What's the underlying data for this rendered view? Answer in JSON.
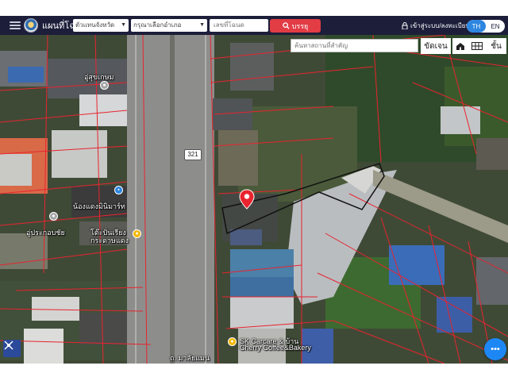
{
  "app": {
    "title": "แผนที่โฉนด"
  },
  "header": {
    "province": {
      "value": "ตัวแทนจังหวัด"
    },
    "district": {
      "value": "กรุณาเลือกอำเภอ"
    },
    "deed": {
      "placeholder": "เลขที่โฉนด"
    },
    "search_label": "บรรยุ",
    "login_label": "เข้าสู่ระบบ/ลงทะเบียน",
    "lang": {
      "th": "TH",
      "en": "EN"
    }
  },
  "map": {
    "place_search": {
      "placeholder": "ค้นหาสถานที่สำคัญ"
    },
    "tools": {
      "clear": "ขัดเจน",
      "floors": "ชั้น"
    },
    "route_badge": "321",
    "labels": {
      "a": "อู่สุขเกษม",
      "b": "น้องแดงมินิมาร์ท",
      "c": "อู่ประกอบชัย",
      "d": "โต๊ะปั่นเรียงกระดาษแดง",
      "e": "SK Carcare & บ้าน",
      "f": "Cherry Coffee&Bakery",
      "g": "ถ. มาลัยแมน"
    }
  },
  "colors": {
    "topbar": "#1c1e3a",
    "search_button": "#e23c45",
    "lang_active": "#2d86e0",
    "parcel_line": "#e8242f",
    "marker": "#e8242f",
    "fab": "#1d88f5",
    "layers_button": "#2c4a9a"
  },
  "icons": {
    "menu": "hamburger-icon",
    "logo": "emblem-logo",
    "search": "magnifier-icon",
    "login": "lock-icon",
    "home": "home-icon",
    "grid": "grid-icon",
    "layers": "layers-icon",
    "more": "more-icon",
    "marker": "location-marker-icon"
  }
}
